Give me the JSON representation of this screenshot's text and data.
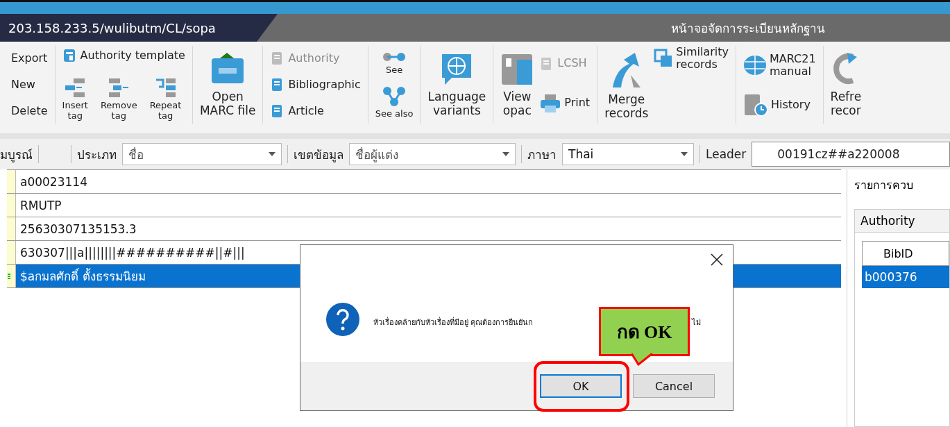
{
  "title_bar": {
    "url": "203.158.233.5/wulibutm/CL/sopa",
    "title": "หน้าจอจัดการระเบียนหลักฐาน"
  },
  "toolbar": {
    "groups": [
      {
        "kind": "column",
        "items": [
          {
            "kind": "text",
            "label": "Export",
            "disabled": false
          },
          {
            "kind": "text",
            "label": "New",
            "disabled": false
          },
          {
            "kind": "text",
            "label": "Delete",
            "disabled": false
          }
        ]
      },
      {
        "kind": "template",
        "items": [
          {
            "kind": "small",
            "label": "Authority template",
            "disabled": false
          },
          {
            "kind": "tall",
            "label": "Insert\ntag",
            "disabled": false
          },
          {
            "kind": "tall",
            "label": "Remove\ntag",
            "disabled": false
          },
          {
            "kind": "tall",
            "label": "Repeat\ntag",
            "disabled": false
          }
        ]
      },
      {
        "kind": "large",
        "items": [
          {
            "kind": "large",
            "label": "Open\nMARC file",
            "disabled": false
          }
        ]
      },
      {
        "kind": "column",
        "items": [
          {
            "kind": "small",
            "label": "Authority",
            "disabled": true
          },
          {
            "kind": "small",
            "label": "Bibliographic",
            "disabled": false
          },
          {
            "kind": "small",
            "label": "Article",
            "disabled": false
          }
        ]
      },
      {
        "kind": "column",
        "items": [
          {
            "kind": "tall",
            "label": "See",
            "disabled": false
          },
          {
            "kind": "tall",
            "label": "See also",
            "disabled": false
          }
        ]
      },
      {
        "kind": "large",
        "items": [
          {
            "kind": "large",
            "label": "Language\nvariants",
            "disabled": false
          }
        ]
      },
      {
        "kind": "pair",
        "items": [
          {
            "kind": "large",
            "label": "View\nopac",
            "disabled": false
          },
          {
            "kind": "small",
            "label": "LCSH",
            "disabled": true
          },
          {
            "kind": "small",
            "label": "Print",
            "disabled": false
          }
        ]
      },
      {
        "kind": "pair",
        "items": [
          {
            "kind": "large",
            "label": "Merge\nrecords",
            "disabled": false
          },
          {
            "kind": "small",
            "label": "Similarity\nrecords",
            "disabled": false
          }
        ]
      },
      {
        "kind": "column",
        "items": [
          {
            "kind": "small",
            "label": "MARC21\nmanual",
            "disabled": false
          },
          {
            "kind": "small",
            "label": "History",
            "disabled": false
          }
        ]
      },
      {
        "kind": "large",
        "items": [
          {
            "kind": "large",
            "label": "Refre\nrecor",
            "disabled": false
          }
        ]
      }
    ]
  },
  "filter_bar": {
    "status": "มบูรณ์",
    "fields": [
      {
        "label": "ประเภท",
        "value": "ชื่อ",
        "disabled": true
      },
      {
        "label": "เขตข้อมูล",
        "value": "ชื่อผู้แต่ง",
        "disabled": true
      },
      {
        "label": "ภาษา",
        "value": "Thai",
        "disabled": false
      }
    ],
    "leader": {
      "label": "Leader",
      "value": "00191cz##a220008"
    }
  },
  "table": {
    "rows": [
      {
        "value": "a00023114",
        "selected": false
      },
      {
        "value": "RMUTP",
        "selected": false
      },
      {
        "value": "25630307135153.3",
        "selected": false
      },
      {
        "value": "630307|||a||||||||##########||#|||",
        "selected": false
      },
      {
        "value": "$aกมลศักดิ์ ตั้งธรรมนิยม",
        "selected": true
      }
    ]
  },
  "side_panel": {
    "title": "รายการควบ",
    "tab": "Authority",
    "column": "BibID",
    "rows": [
      {
        "value": "b000376",
        "selected": true
      }
    ]
  },
  "dialog": {
    "message_parts": [
      "หัวเรื่องคล้ายกับหัวเรื่องที่มีอยู่ คุณต้องการยืนยันก",
      "ไม่"
    ],
    "buttons": [
      {
        "label": "OK",
        "focused": true
      },
      {
        "label": "Cancel",
        "focused": false
      }
    ]
  },
  "callout": {
    "text": "กด OK"
  }
}
